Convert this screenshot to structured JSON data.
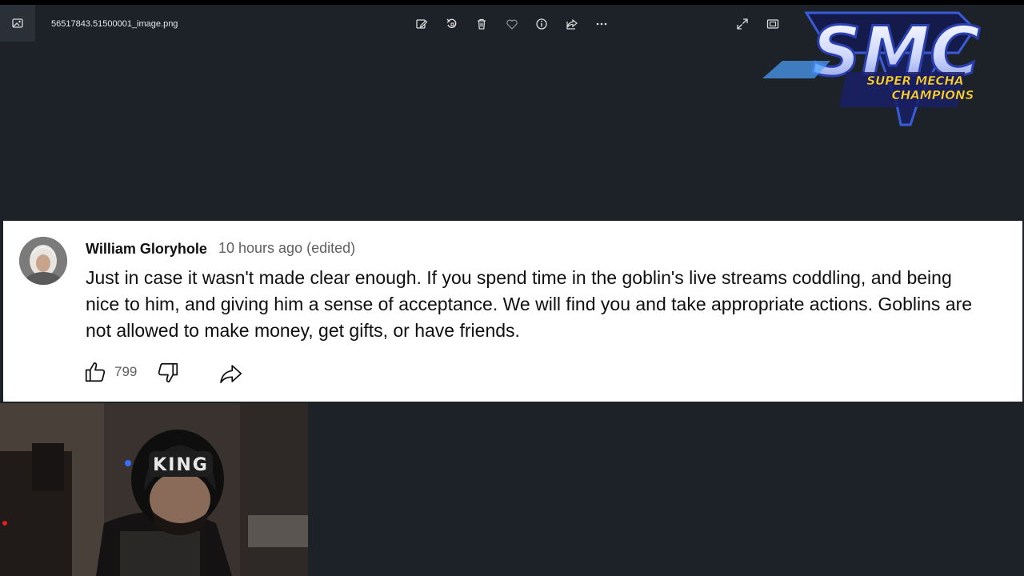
{
  "viewer": {
    "filename": "56517843.51500001_image.png",
    "toolbar": [
      "edit-image",
      "rotate",
      "delete",
      "favorite",
      "info",
      "share",
      "more"
    ],
    "window_controls": [
      "fullscreen",
      "fit",
      "zoom"
    ]
  },
  "overlay_logo": {
    "abbr": "SMC",
    "line1": "SUPER MECHA",
    "line2": "CHAMPIONS"
  },
  "comment": {
    "author": "William Gloryhole",
    "timestamp": "10 hours ago (edited)",
    "text": "Just in case it wasn't made clear enough. If you spend time in the goblin's live streams coddling, and being nice to him, and giving him a sense of acceptance. We will find you and take appropriate actions. Goblins are not allowed to make money, get gifts, or have friends.",
    "like_count": "799"
  },
  "webcam": {
    "beanie_text": "KING"
  },
  "colors": {
    "viewer_bg": "#1c2228",
    "card_bg": "#ffffff",
    "text_primary": "#0f0f0f",
    "text_secondary": "#606060"
  }
}
